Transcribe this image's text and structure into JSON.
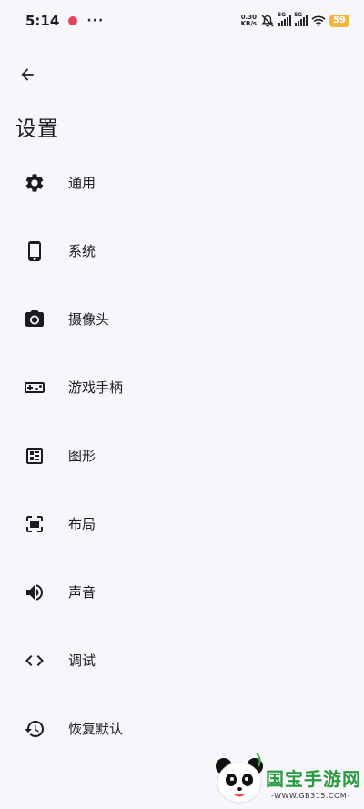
{
  "status_bar": {
    "time": "5:14",
    "speed_value": "0.30",
    "speed_unit": "KB/s",
    "net1": "5G",
    "net2": "5G",
    "battery": "59"
  },
  "header": {
    "title": "设置"
  },
  "settings": {
    "items": [
      {
        "label": "通用",
        "icon": "gear-icon"
      },
      {
        "label": "系统",
        "icon": "phone-icon"
      },
      {
        "label": "摄像头",
        "icon": "camera-icon"
      },
      {
        "label": "游戏手柄",
        "icon": "gamepad-icon"
      },
      {
        "label": "图形",
        "icon": "graphics-icon"
      },
      {
        "label": "布局",
        "icon": "layout-icon"
      },
      {
        "label": "声音",
        "icon": "volume-icon"
      },
      {
        "label": "调试",
        "icon": "code-icon"
      },
      {
        "label": "恢复默认",
        "icon": "restore-icon"
      }
    ]
  },
  "watermark": {
    "name": "国宝手游网",
    "url": "-WWW.GB315.COM-"
  }
}
